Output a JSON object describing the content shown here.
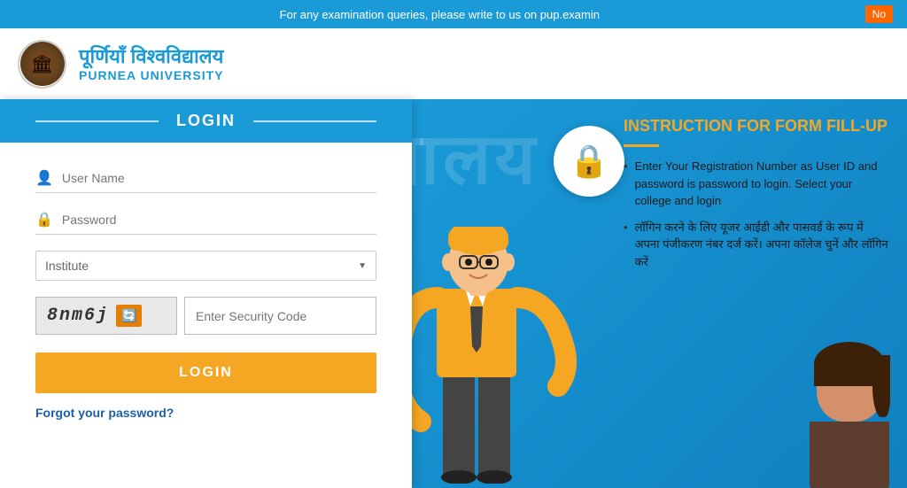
{
  "topbar": {
    "notice": "For any examination queries, please write to us on pup.examin",
    "notify_btn": "No"
  },
  "header": {
    "university_hindi": "पूर्णियाँ विश्वविद्यालय",
    "university_english": "PURNEA UNIVERSITY"
  },
  "login": {
    "title": "LOGIN",
    "username_placeholder": "User Name",
    "password_placeholder": "Password",
    "institute_placeholder": "Institute",
    "captcha_value": "8nm6j",
    "captcha_placeholder": "Enter Security Code",
    "login_btn": "LOGIN",
    "forgot_link": "Forgot your password?"
  },
  "instructions": {
    "title": "INSTRUCTION FOR FORM FILL-UP",
    "items": [
      "Enter Your Registration Number as User ID and password is password to login. Select your college and login",
      "लॉगिन करने के लिए यूजर आईडी और पासवर्ड के रूप में अपना पंजीकरण नंबर दर्ज करें। अपना कॉलेज चुनें और लॉगिन करें"
    ]
  },
  "watermark": "विश्वविद्यालय"
}
